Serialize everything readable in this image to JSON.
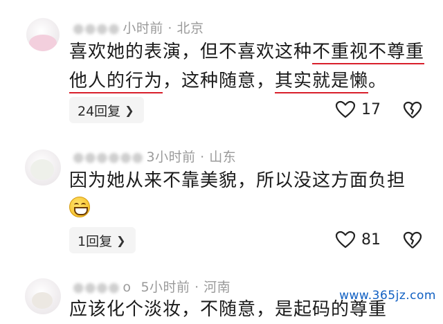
{
  "comments": [
    {
      "meta": "小时前 · 北京",
      "text_plain_1": "喜欢她的表演，但不喜欢这种",
      "text_ul_1": "不重视不尊重",
      "text_ul_2": "他人的行为",
      "text_plain_2": "，这种随意，",
      "text_ul_3": "其实就是懒",
      "text_plain_3": "。",
      "reply_label": "24回复",
      "likes": "17"
    },
    {
      "meta": "3小时前 · 山东",
      "text": "因为她从来不靠美貌，所以没这方面负担",
      "reply_label": "1回复",
      "likes": "81"
    },
    {
      "meta_name_fragment": "o",
      "meta": "5小时前 · 河南",
      "text_partial": "应该化个淡妆，不随意，是起码的尊重"
    }
  ],
  "icons": {
    "reply_chevron": "chevron-right-icon",
    "like": "heart-icon",
    "dislike": "broken-heart-icon",
    "emoji": "grinning-face-icon"
  },
  "colors": {
    "underline": "#d81e2a",
    "meta_text": "#9a9a9a",
    "watermark": "#0f5fc2"
  },
  "watermark": "www.365jz.com"
}
